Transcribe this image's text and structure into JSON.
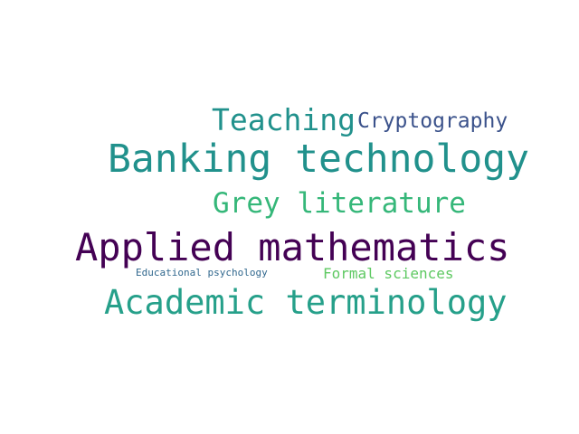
{
  "word_cloud": {
    "words": [
      {
        "id": "teaching",
        "text": "Teaching",
        "color": "#21918c"
      },
      {
        "id": "cryptography",
        "text": "Cryptography",
        "color": "#3b528b"
      },
      {
        "id": "banking",
        "text": "Banking technology",
        "color": "#21918c"
      },
      {
        "id": "grey",
        "text": "Grey literature",
        "color": "#35b779"
      },
      {
        "id": "applied",
        "text": "Applied mathematics",
        "color": "#440154"
      },
      {
        "id": "educational",
        "text": "Educational psychology",
        "color": "#31688e"
      },
      {
        "id": "formal",
        "text": "Formal sciences",
        "color": "#5ec962"
      },
      {
        "id": "academic",
        "text": "Academic terminology",
        "color": "#26a08a"
      }
    ]
  }
}
